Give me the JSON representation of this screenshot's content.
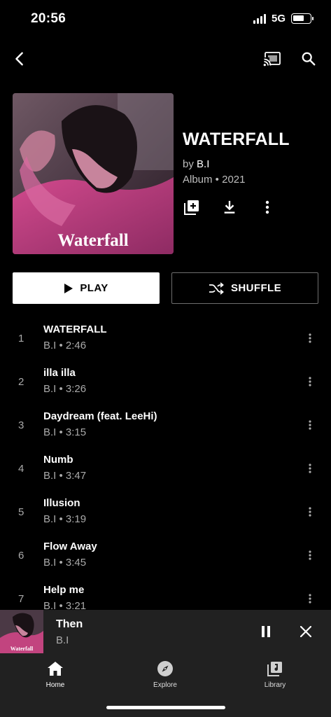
{
  "status_bar": {
    "time": "20:56",
    "network": "5G"
  },
  "top_bar": {
    "back_icon": "chevron-left-icon",
    "cast_icon": "cast-icon",
    "search_icon": "search-icon"
  },
  "album": {
    "title": "WATERFALL",
    "by_prefix": "by",
    "artist": "B.I",
    "meta": "Album • 2021",
    "art_caption": "Waterfall"
  },
  "actions": {
    "play_label": "PLAY",
    "shuffle_label": "SHUFFLE"
  },
  "tracks": [
    {
      "num": "1",
      "title": "WATERFALL",
      "sub": "B.I • 2:46"
    },
    {
      "num": "2",
      "title": "illa illa",
      "sub": "B.I • 3:26"
    },
    {
      "num": "3",
      "title": "Daydream (feat. LeeHi)",
      "sub": "B.I • 3:15"
    },
    {
      "num": "4",
      "title": "Numb",
      "sub": "B.I • 3:47"
    },
    {
      "num": "5",
      "title": "Illusion",
      "sub": "B.I • 3:19"
    },
    {
      "num": "6",
      "title": "Flow Away",
      "sub": "B.I • 3:45"
    },
    {
      "num": "7",
      "title": "Help me",
      "sub": "B.I • 3:21"
    }
  ],
  "mini_player": {
    "title": "Then",
    "artist": "B.I",
    "art_caption": "Waterfall"
  },
  "nav": {
    "home": "Home",
    "explore": "Explore",
    "library": "Library"
  },
  "colors": {
    "background": "#000000",
    "surface": "#212121",
    "secondary_text": "#aaaaaa"
  }
}
